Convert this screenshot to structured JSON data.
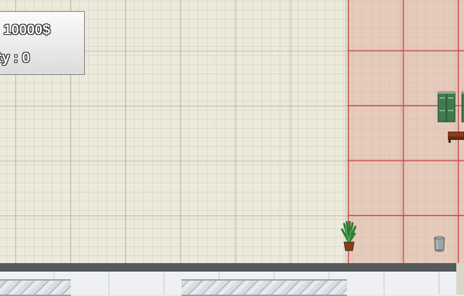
{
  "hud": {
    "money_text": "10000$",
    "secondary_text": "ty : 0"
  },
  "scene": {
    "floor_color": "#ebeadb",
    "zone_color": "#deb0a0",
    "zone_grid_color": "#c84646",
    "wall_color": "#555a5c",
    "objects": [
      {
        "name": "potted-plant",
        "icon": "potted-plant-icon"
      },
      {
        "name": "trash-can",
        "icon": "trash-can-icon"
      },
      {
        "name": "green-lockers",
        "icon": "locker-icon"
      },
      {
        "name": "wooden-bench",
        "icon": "bench-icon"
      }
    ]
  }
}
